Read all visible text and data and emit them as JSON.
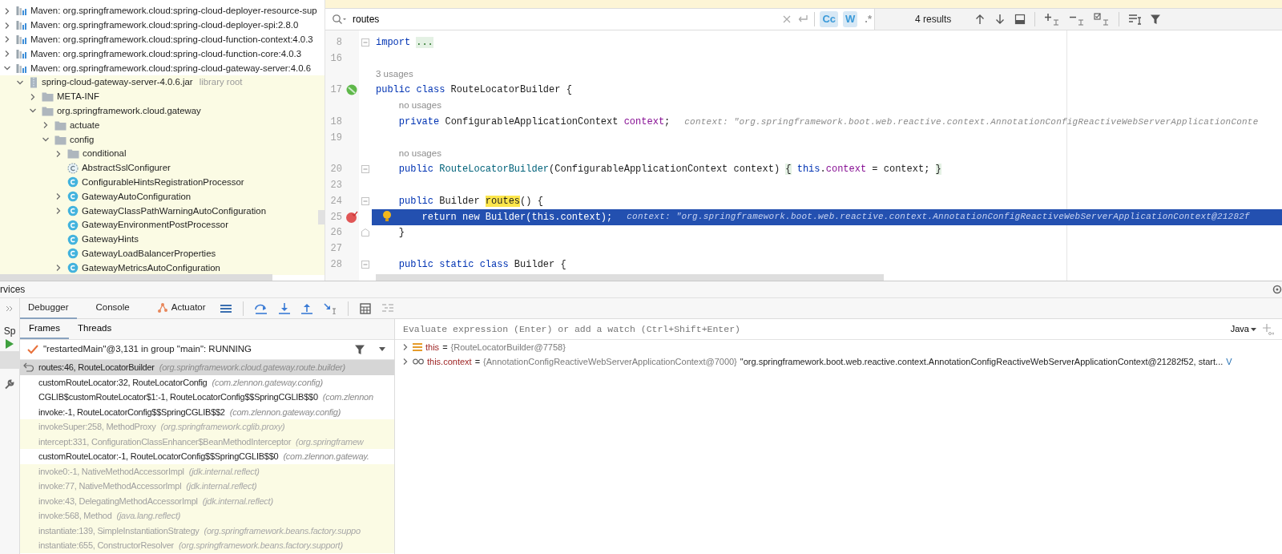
{
  "project_tree": {
    "items": [
      {
        "kind": "maven",
        "label": "Maven: org.springframework.cloud:spring-cloud-deployer-resource-sup",
        "expanded": false
      },
      {
        "kind": "maven",
        "label": "Maven: org.springframework.cloud:spring-cloud-deployer-spi:2.8.0",
        "expanded": false
      },
      {
        "kind": "maven",
        "label": "Maven: org.springframework.cloud:spring-cloud-function-context:4.0.3",
        "expanded": false
      },
      {
        "kind": "maven",
        "label": "Maven: org.springframework.cloud:spring-cloud-function-core:4.0.3",
        "expanded": false
      },
      {
        "kind": "maven",
        "label": "Maven: org.springframework.cloud:spring-cloud-gateway-server:4.0.6",
        "expanded": true,
        "children": [
          {
            "kind": "jar",
            "label": "spring-cloud-gateway-server-4.0.6.jar",
            "note": "library root",
            "expanded": true,
            "children": [
              {
                "kind": "folder",
                "label": "META-INF",
                "expanded": false
              },
              {
                "kind": "folder",
                "label": "org.springframework.cloud.gateway",
                "expanded": true,
                "children": [
                  {
                    "kind": "folder",
                    "label": "actuate",
                    "expanded": false
                  },
                  {
                    "kind": "folder",
                    "label": "config",
                    "expanded": true,
                    "children": [
                      {
                        "kind": "folder",
                        "label": "conditional",
                        "expanded": false
                      },
                      {
                        "kind": "abstract-class",
                        "label": "AbstractSslConfigurer"
                      },
                      {
                        "kind": "class",
                        "label": "ConfigurableHintsRegistrationProcessor"
                      },
                      {
                        "kind": "class",
                        "label": "GatewayAutoConfiguration",
                        "expanded": false
                      },
                      {
                        "kind": "class",
                        "label": "GatewayClassPathWarningAutoConfiguration",
                        "expanded": false
                      },
                      {
                        "kind": "class",
                        "label": "GatewayEnvironmentPostProcessor"
                      },
                      {
                        "kind": "class",
                        "label": "GatewayHints"
                      },
                      {
                        "kind": "class",
                        "label": "GatewayLoadBalancerProperties"
                      },
                      {
                        "kind": "class",
                        "label": "GatewayMetricsAutoConfiguration",
                        "expanded": false
                      }
                    ]
                  }
                ]
              }
            ]
          }
        ]
      }
    ]
  },
  "editor": {
    "find": {
      "value": "routes",
      "toggles": [
        {
          "label": "Cc",
          "on": true
        },
        {
          "label": "W",
          "on": true
        },
        {
          "label": ".*",
          "on": false
        }
      ],
      "results": "4 results"
    },
    "lines": [
      {
        "number": "8",
        "current": false,
        "fold_start": true,
        "tokens": [
          {
            "t": "import",
            "kind": "keyword"
          },
          {
            "t": "...",
            "kind": "folded"
          }
        ]
      },
      {
        "number": "16",
        "current": false
      },
      {
        "number": "17",
        "usage_hint": "3 usages",
        "current": false,
        "implemented": true,
        "tokens": [
          {
            "t": "public class",
            "kind": "keyword"
          },
          {
            "t": " RouteLocatorBuilder {"
          }
        ]
      },
      {
        "number": "18",
        "usage_hint": "no usages",
        "current": false,
        "tokens": [
          {
            "t": "    private",
            "kind": "keyword"
          },
          {
            "t": " ConfigurableApplicationContext "
          },
          {
            "t": "context",
            "kind": "field"
          },
          {
            "t": ";"
          },
          {
            "t": "context: \"org.springframework.boot.web.reactive.context.AnnotationConfigReactiveWebServerApplicationConte",
            "kind": "value"
          }
        ]
      },
      {
        "number": "19",
        "current": false
      },
      {
        "number": "20",
        "usage_hint": "no usages",
        "current": false,
        "fold_start": true,
        "tokens": [
          {
            "t": "    public",
            "kind": "keyword"
          },
          {
            "t": " RouteLocatorBuilder",
            "kind": "declaration"
          },
          {
            "t": "(ConfigurableApplicationContext context) "
          },
          {
            "t": "{",
            "kind": "fold"
          },
          {
            "t": " this",
            "kind": "keyword"
          },
          {
            "t": "."
          },
          {
            "t": "context",
            "kind": "field"
          },
          {
            "t": " = context; "
          },
          {
            "t": "}",
            "kind": "fold"
          }
        ]
      },
      {
        "number": "23",
        "current": false
      },
      {
        "number": "24",
        "current": false,
        "fold_start": true,
        "tokens": [
          {
            "t": "    public",
            "kind": "keyword"
          },
          {
            "t": " Builder "
          },
          {
            "t": "routes",
            "kind": "match"
          },
          {
            "t": "() {"
          }
        ]
      },
      {
        "number": "25",
        "current": true,
        "breakpoint": true,
        "intention": true,
        "tokens": [
          {
            "t": "        return new",
            "kind": "keyword"
          },
          {
            "t": " Builder("
          },
          {
            "t": "this",
            "kind": "keyword"
          },
          {
            "t": ".context",
            "kind": "field"
          },
          {
            "t": ");"
          },
          {
            "t": "context: \"org.springframework.boot.web.reactive.context.AnnotationConfigReactiveWebServerApplicationContext@21282f",
            "kind": "value"
          }
        ]
      },
      {
        "number": "26",
        "current": false,
        "fold_end": true,
        "tokens": [
          {
            "t": "    }"
          }
        ]
      },
      {
        "number": "27",
        "current": false
      },
      {
        "number": "28",
        "current": false,
        "fold_start": true,
        "tokens": [
          {
            "t": "    public static class",
            "kind": "keyword"
          },
          {
            "t": " Builder {"
          }
        ]
      }
    ]
  },
  "services": {
    "title": "rvices"
  },
  "debugger": {
    "tabs": [
      {
        "label": "Debugger",
        "selected": true,
        "kind": "text"
      },
      {
        "label": "Console",
        "selected": false,
        "kind": "text"
      },
      {
        "label": "Actuator",
        "selected": false,
        "kind": "plugin"
      }
    ],
    "side_label": "Sp",
    "frame_tabs": [
      {
        "label": "Frames",
        "selected": true
      },
      {
        "label": "Threads",
        "selected": false
      }
    ],
    "thread": "\"restartedMain\"@3,131 in group \"main\": RUNNING",
    "frames": [
      {
        "method": "routes:46, RouteLocatorBuilder",
        "package": "(org.springframework.cloud.gateway.route.builder)",
        "selected": true,
        "library": false
      },
      {
        "method": "customRouteLocator:32, RouteLocatorConfig",
        "package": "(com.zlennon.gateway.config)",
        "selected": false,
        "library": false
      },
      {
        "method": "CGLIB$customRouteLocator$1:-1, RouteLocatorConfig$$SpringCGLIB$$0",
        "package": "(com.zlennon",
        "selected": false,
        "library": false
      },
      {
        "method": "invoke:-1, RouteLocatorConfig$$SpringCGLIB$$2",
        "package": "(com.zlennon.gateway.config)",
        "selected": false,
        "library": false
      },
      {
        "method": "invokeSuper:258, MethodProxy",
        "package": "(org.springframework.cglib.proxy)",
        "selected": false,
        "library": true
      },
      {
        "method": "intercept:331, ConfigurationClassEnhancer$BeanMethodInterceptor",
        "package": "(org.springframew",
        "selected": false,
        "library": true
      },
      {
        "method": "customRouteLocator:-1, RouteLocatorConfig$$SpringCGLIB$$0",
        "package": "(com.zlennon.gateway.",
        "selected": false,
        "library": false
      },
      {
        "method": "invoke0:-1, NativeMethodAccessorImpl",
        "package": "(jdk.internal.reflect)",
        "selected": false,
        "library": true
      },
      {
        "method": "invoke:77, NativeMethodAccessorImpl",
        "package": "(jdk.internal.reflect)",
        "selected": false,
        "library": true
      },
      {
        "method": "invoke:43, DelegatingMethodAccessorImpl",
        "package": "(jdk.internal.reflect)",
        "selected": false,
        "library": true
      },
      {
        "method": "invoke:568, Method",
        "package": "(java.lang.reflect)",
        "selected": false,
        "library": true
      },
      {
        "method": "instantiate:139, SimpleInstantiationStrategy",
        "package": "(org.springframework.beans.factory.suppo",
        "selected": false,
        "library": true
      },
      {
        "method": "instantiate:655, ConstructorResolver",
        "package": "(org.springframework.beans.factory.support)",
        "selected": false,
        "library": true
      }
    ],
    "evaluate": {
      "placeholder": "Evaluate expression (Enter) or add a watch (Ctrl+Shift+Enter)",
      "language": "Java"
    },
    "variables": [
      {
        "kind": "field",
        "name": "this",
        "operator": "=",
        "value": "{RouteLocatorBuilder@7758}",
        "expanded": false
      },
      {
        "kind": "watch",
        "name": "this.context",
        "operator": "=",
        "value": "{AnnotationConfigReactiveWebServerApplicationContext@7000}",
        "string": "\"org.springframework.boot.web.reactive.context.AnnotationConfigReactiveWebServerApplicationContext@21282f52, start...",
        "link": "V",
        "expanded": false
      }
    ]
  }
}
